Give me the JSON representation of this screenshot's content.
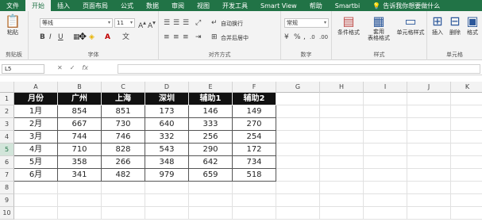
{
  "ribbon_tabs": [
    "文件",
    "开始",
    "插入",
    "页面布局",
    "公式",
    "数据",
    "审阅",
    "视图",
    "开发工具",
    "Smart View",
    "帮助",
    "Smartbi"
  ],
  "active_tab": "开始",
  "tell_me": "告诉我你想要做什么",
  "clipboard": {
    "paste": "粘贴",
    "label": "剪贴板"
  },
  "font": {
    "name": "等线",
    "size": "11",
    "label": "字体"
  },
  "alignment": {
    "wrap": "自动换行",
    "merge": "合并后居中",
    "label": "对齐方式"
  },
  "number": {
    "format": "常规",
    "label": "数字"
  },
  "styles": {
    "conditional": "条件格式",
    "table": "套用\n表格格式",
    "cell": "单元格样式",
    "label": "样式"
  },
  "cells": {
    "insert": "插入",
    "delete": "删除",
    "format": "格式",
    "label": "单元格"
  },
  "formula_bar": {
    "name_box": "L5",
    "fx": "fx"
  },
  "columns": [
    "A",
    "B",
    "C",
    "D",
    "E",
    "F",
    "G",
    "H",
    "I",
    "J",
    "K"
  ],
  "rows": [
    "1",
    "2",
    "3",
    "4",
    "5",
    "6",
    "7",
    "8",
    "9",
    "10"
  ],
  "selected_row": "5",
  "table": {
    "header": [
      "月份",
      "广州",
      "上海",
      "深圳",
      "辅助1",
      "辅助2"
    ],
    "rows": [
      [
        "1月",
        "854",
        "851",
        "173",
        "146",
        "149"
      ],
      [
        "2月",
        "667",
        "730",
        "640",
        "333",
        "270"
      ],
      [
        "3月",
        "744",
        "746",
        "332",
        "256",
        "254"
      ],
      [
        "4月",
        "710",
        "828",
        "543",
        "290",
        "172"
      ],
      [
        "5月",
        "358",
        "266",
        "348",
        "642",
        "734"
      ],
      [
        "6月",
        "341",
        "482",
        "979",
        "659",
        "518"
      ]
    ]
  },
  "colors": {
    "excel_green": "#217346",
    "header_fill": "#111111"
  }
}
